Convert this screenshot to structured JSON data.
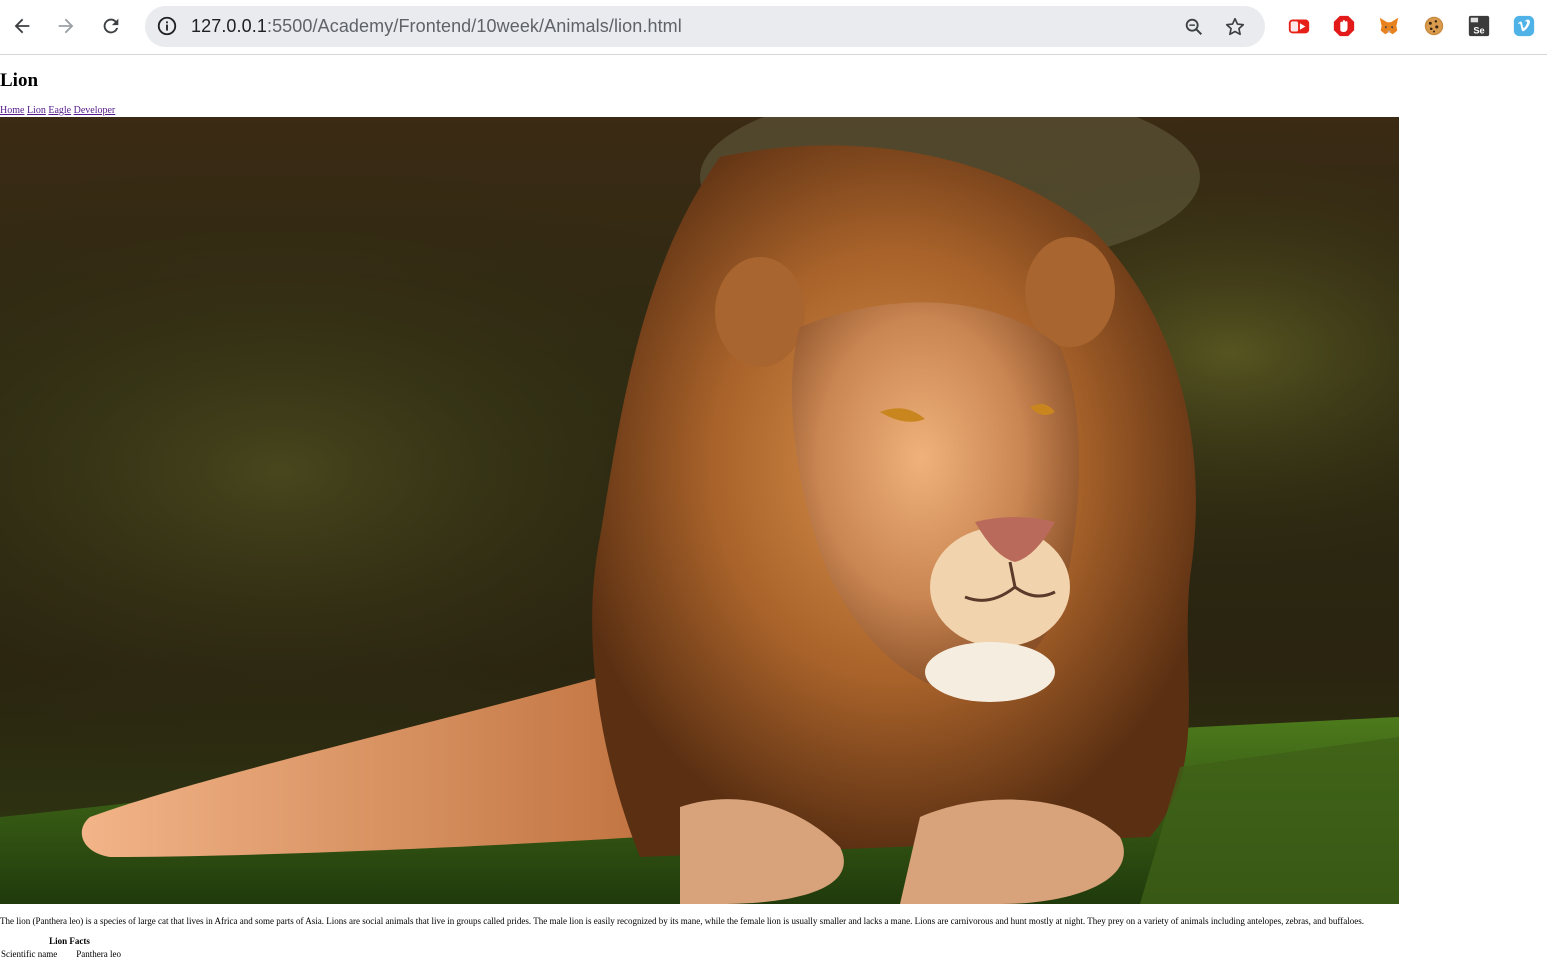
{
  "browser": {
    "back_icon": "arrow-left-icon",
    "forward_icon": "arrow-right-icon",
    "reload_icon": "reload-icon",
    "site_info_icon": "info-icon",
    "url_host": "127.0.0.1",
    "url_rest": ":5500/Academy/Frontend/10week/Animals/lion.html",
    "zoom_icon": "zoom-icon",
    "bookmark_icon": "star-icon",
    "extensions": [
      "youtube-icon",
      "adblock-icon",
      "metamask-icon",
      "cookie-icon",
      "selenium-icon",
      "vimeo-icon"
    ],
    "extension_se_label": "Se"
  },
  "page": {
    "title": "Lion",
    "nav": [
      "Home",
      "Lion",
      "Eagle",
      "Developer"
    ],
    "description": "The lion (Panthera leo) is a species of large cat that lives in Africa and some parts of Asia. Lions are social animals that live in groups called prides. The male lion is easily recognized by its mane, while the female lion is usually smaller and lacks a mane. Lions are carnivorous and hunt mostly at night. They prey on a variety of animals including antelopes, zebras, and buffaloes.",
    "facts": {
      "caption": "Lion Facts",
      "rows": [
        {
          "label": "Scientific name",
          "value": "Panthera leo"
        }
      ]
    }
  },
  "colors": {
    "link": "#551a8b",
    "omnibox_bg": "#e9ebee"
  }
}
